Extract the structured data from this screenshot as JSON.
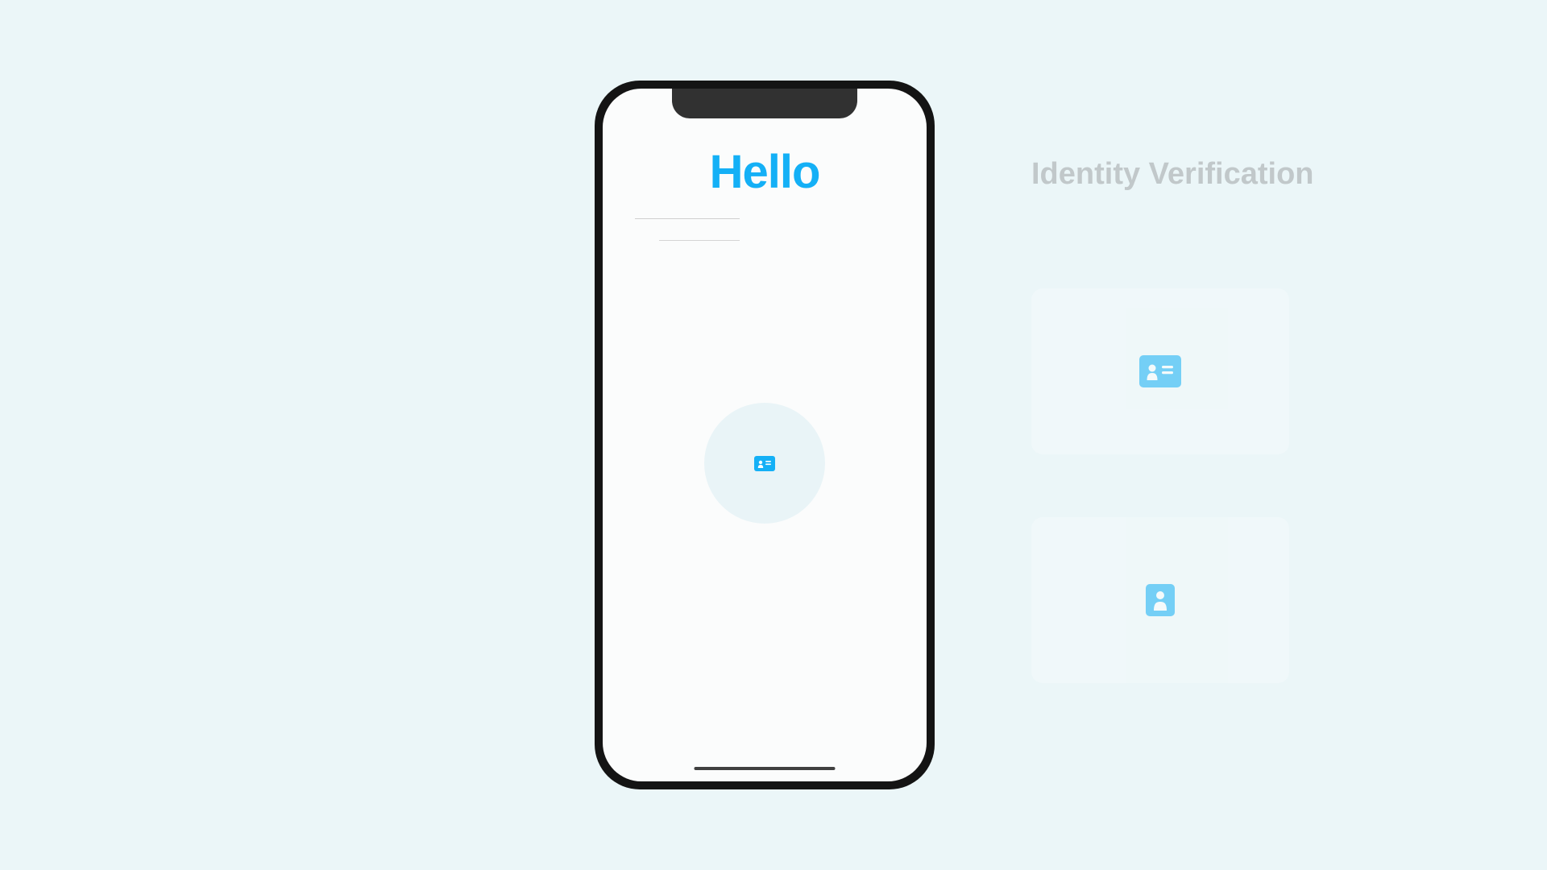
{
  "phone": {
    "title": "Hello",
    "icon_name": "id-card-icon"
  },
  "side": {
    "title": "Identity Verification",
    "cards": [
      {
        "icon": "id-card-icon"
      },
      {
        "icon": "person-icon"
      }
    ]
  }
}
